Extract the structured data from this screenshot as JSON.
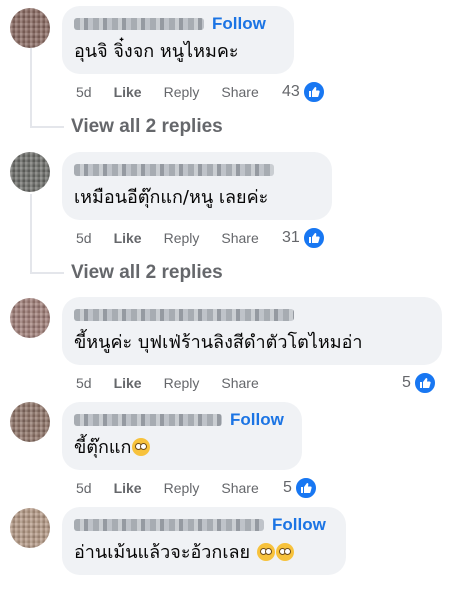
{
  "comments": [
    {
      "text": "อุนจิ จิ๋งจก หนูไหมคะ",
      "follow_label": "Follow",
      "time": "5d",
      "like_label": "Like",
      "reply_label": "Reply",
      "share_label": "Share",
      "reaction_count": "43",
      "view_replies": "View all 2 replies"
    },
    {
      "text": "เหมือนอีตุ๊กแก/หนู เลยค่ะ",
      "time": "5d",
      "like_label": "Like",
      "reply_label": "Reply",
      "share_label": "Share",
      "reaction_count": "31",
      "view_replies": "View all 2 replies"
    },
    {
      "text": "ขี้หนูค่ะ บุฟเฟ่ร้านลิงสีดำตัวโตไหมอ่า",
      "time": "5d",
      "like_label": "Like",
      "reply_label": "Reply",
      "share_label": "Share",
      "reaction_count": "5"
    },
    {
      "text": "ขี้ตุ๊กแก",
      "follow_label": "Follow",
      "time": "5d",
      "like_label": "Like",
      "reply_label": "Reply",
      "share_label": "Share",
      "reaction_count": "5"
    },
    {
      "text": "อ่านเม้นแล้วจะอ้วกเลย",
      "follow_label": "Follow",
      "reaction_count": ""
    }
  ],
  "colors": {
    "bubble": "#f0f2f5",
    "follow": "#1b74e4",
    "meta": "#65676b",
    "like_blue": "#1877f2"
  },
  "icons": [
    "like-icon",
    "flushed-face-emoji"
  ]
}
